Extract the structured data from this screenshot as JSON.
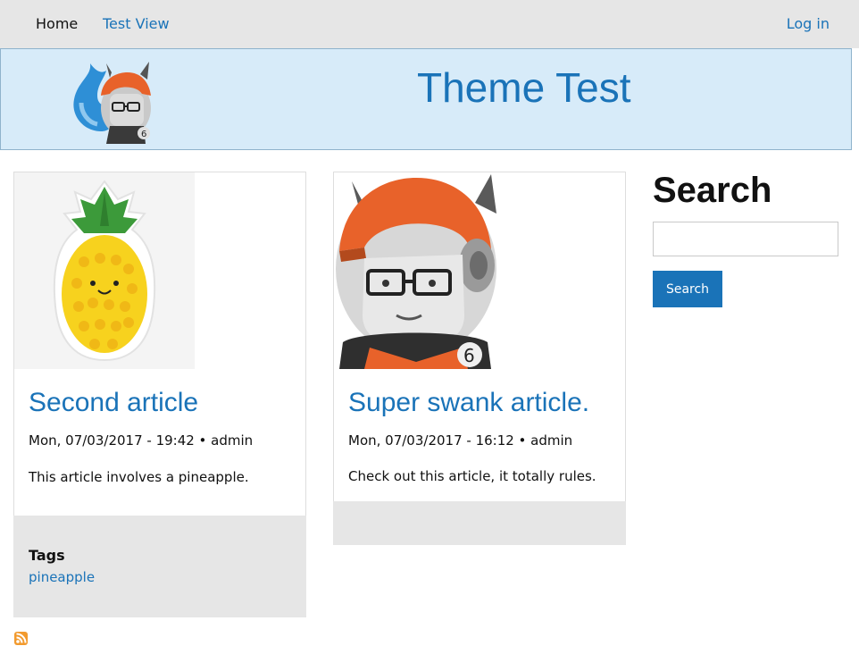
{
  "nav": {
    "home": "Home",
    "test_view": "Test View",
    "login": "Log in"
  },
  "header": {
    "site_name": "Theme Test"
  },
  "articles": [
    {
      "title": "Second article",
      "meta": "Mon, 07/03/2017 - 19:42 • admin",
      "body": "This article involves a pineapple.",
      "tags_label": "Tags",
      "tags": [
        "pineapple"
      ]
    },
    {
      "title": "Super swank article.",
      "meta": "Mon, 07/03/2017 - 16:12 • admin",
      "body": "Check out this article, it totally rules."
    }
  ],
  "search": {
    "title": "Search",
    "input_value": "",
    "button_label": "Search"
  },
  "icons": {
    "logo": "drupal-astronaut-logo-icon",
    "article_1_image": "pineapple-image",
    "article_2_image": "astronaut-image",
    "feed": "rss-feed-icon"
  },
  "colors": {
    "link": "#1a73b8",
    "topbar": "#e6e6e6",
    "header_bg": "#d7ebf9",
    "button": "#1a73b8",
    "rss": "#f29a2e"
  }
}
